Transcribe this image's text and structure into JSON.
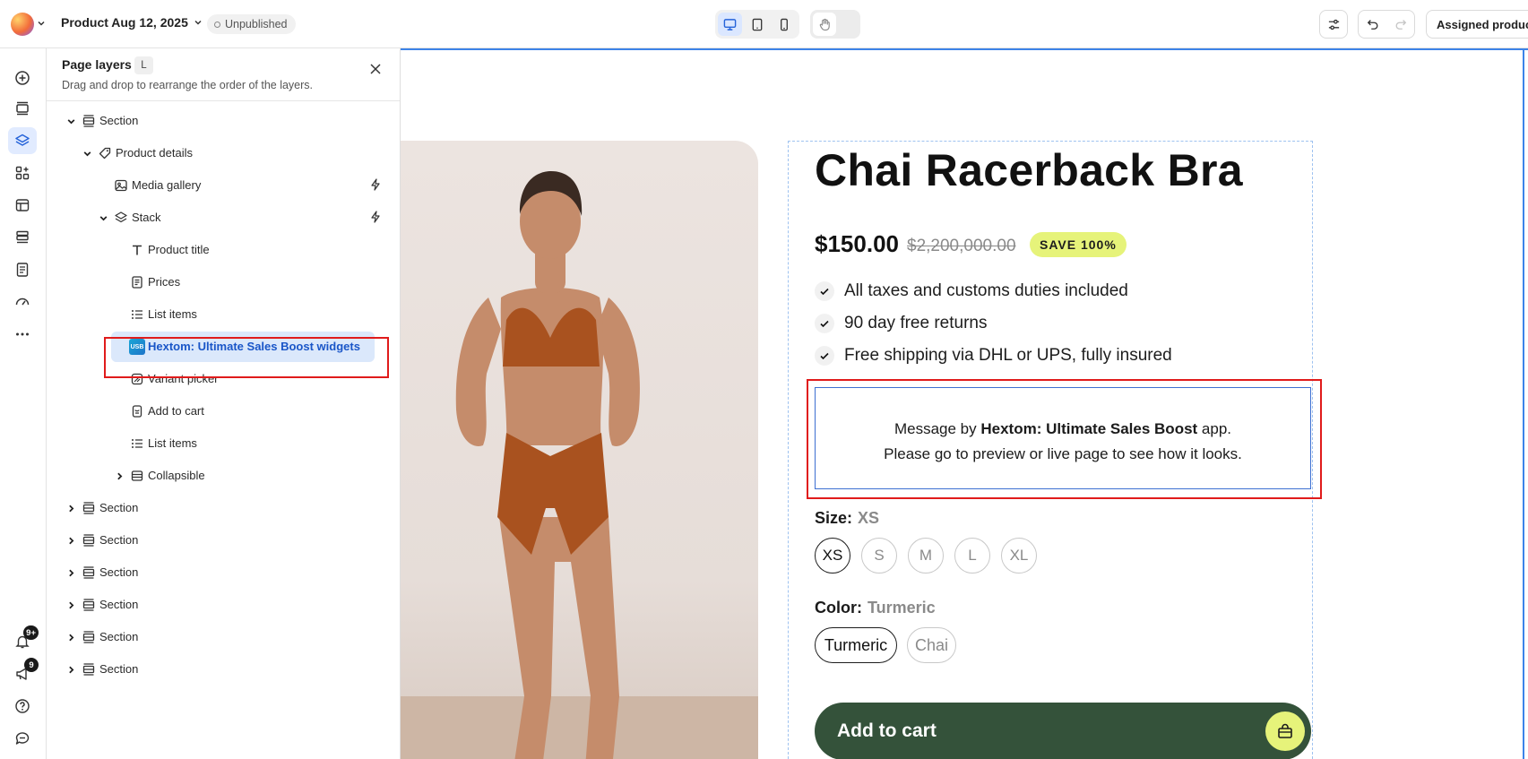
{
  "topbar": {
    "page_name": "Product Aug 12, 2025",
    "status": "Unpublished",
    "assign_label": "Assigned product"
  },
  "rail": {
    "notifications_badge": "9+",
    "announcements_badge": "9"
  },
  "panel": {
    "title": "Page layers",
    "shortcut": "L",
    "subtitle": "Drag and drop to rearrange the order of the layers.",
    "layers": [
      {
        "label": "Section",
        "icon": "section-icon",
        "expanded": true
      },
      {
        "label": "Product details",
        "icon": "tag-icon",
        "expanded": true
      },
      {
        "label": "Media gallery",
        "icon": "gallery-icon",
        "dynamic": true
      },
      {
        "label": "Stack",
        "icon": "stack-icon",
        "expanded": true,
        "dynamic": true
      },
      {
        "label": "Product title",
        "icon": "text-icon"
      },
      {
        "label": "Prices",
        "icon": "prices-icon"
      },
      {
        "label": "List items",
        "icon": "list-icon"
      },
      {
        "label": "Hextom: Ultimate Sales Boost widgets",
        "icon": "usb-app-icon",
        "selected": true
      },
      {
        "label": "Variant picker",
        "icon": "variant-icon"
      },
      {
        "label": "Add to cart",
        "icon": "cart-icon"
      },
      {
        "label": "List items",
        "icon": "list-icon"
      },
      {
        "label": "Collapsible",
        "icon": "collapsible-icon",
        "collapsed": true
      },
      {
        "label": "Section",
        "icon": "section-icon",
        "collapsed": true
      },
      {
        "label": "Section",
        "icon": "section-icon",
        "collapsed": true
      },
      {
        "label": "Section",
        "icon": "section-icon",
        "collapsed": true
      },
      {
        "label": "Section",
        "icon": "section-icon",
        "collapsed": true
      },
      {
        "label": "Section",
        "icon": "section-icon",
        "collapsed": true
      },
      {
        "label": "Section",
        "icon": "section-icon",
        "collapsed": true
      }
    ],
    "app_icon_text": "USB"
  },
  "product": {
    "title": "Chai Racerback Bra",
    "price": "$150.00",
    "compare_price": "$2,200,000.00",
    "save_badge": "SAVE 100%",
    "bullets": [
      "All taxes and customs duties included",
      "90 day free returns",
      "Free shipping via DHL or UPS, fully insured"
    ],
    "app_message": {
      "prefix": "Message by ",
      "app_name": "Hextom: Ultimate Sales Boost",
      "suffix": " app.",
      "line2": "Please go to preview or live page to see how it looks."
    },
    "size_label": "Size:",
    "size_selected": "XS",
    "sizes": [
      "XS",
      "S",
      "M",
      "L",
      "XL"
    ],
    "color_label": "Color:",
    "color_selected": "Turmeric",
    "colors": [
      "Turmeric",
      "Chai"
    ],
    "add_to_cart": "Add to cart"
  },
  "colors": {
    "accent": "#3d83e8",
    "highlight": "#e01b1b",
    "cart_button": "#34523a",
    "badge": "#e6f37a",
    "skin": "#c58c6b",
    "apparel": "#a9521f"
  }
}
